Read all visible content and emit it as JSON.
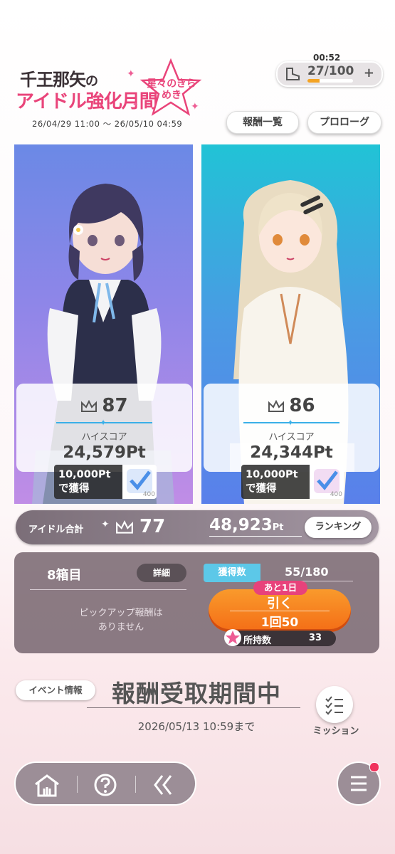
{
  "header": {
    "logo_line1_a": "千王那矢",
    "logo_line1_b": "の",
    "logo_line2": "アイドル強化月間",
    "logo_badge": "星々のきらめき",
    "period": "26/04/29 11:00 〜 26/05/10 04:59",
    "timer": "00:52",
    "stamina_value": "27/100",
    "stamina_fraction": 0.27,
    "reward_list_label": "報酬一覧",
    "prologue_label": "プロローグ"
  },
  "characters": [
    {
      "rank": "87",
      "highscore_label": "ハイスコア",
      "highscore": "24,579Pt",
      "reward_line1": "10,000Pt",
      "reward_line2": "で獲得",
      "reward_count": "400"
    },
    {
      "rank": "86",
      "highscore_label": "ハイスコア",
      "highscore": "24,344Pt",
      "reward_line1": "10,000Pt",
      "reward_line2": "で獲得",
      "reward_count": "400"
    }
  ],
  "total": {
    "label": "アイドル合計",
    "rank": "77",
    "points": "48,923",
    "points_unit": "Pt",
    "ranking_label": "ランキング"
  },
  "gacha": {
    "box_title": "8箱目",
    "detail_label": "詳細",
    "count_label": "獲得数",
    "count_value": "55/180",
    "pickup_text_1": "ピックアップ報酬は",
    "pickup_text_2": "ありません",
    "remaining_label": "あと1日",
    "pull_label": "引く",
    "pull_cost": "1回50",
    "owned_label": "所持数",
    "owned_value": "33"
  },
  "event": {
    "info_label": "イベント情報",
    "status": "報酬受取期間中",
    "deadline": "2026/05/13 10:59まで",
    "mission_label": "ミッション"
  },
  "colors": {
    "accent_pink": "#e9447a",
    "pull_orange": "#f46d16",
    "count_cyan": "#5cc8e8",
    "notification_red": "#f0325c"
  }
}
